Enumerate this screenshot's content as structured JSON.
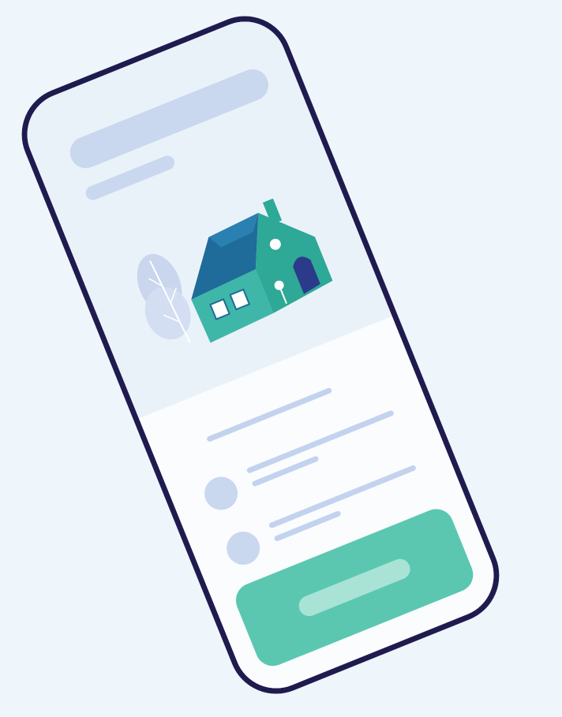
{
  "scene": {
    "background_color": "#eef6fb"
  },
  "phone": {
    "frame_color": "#1f1b4f",
    "screen_color": "#ffffff",
    "header_panel_color": "#eaf2f9",
    "placeholder_color": "#c9d8ef"
  },
  "illustration": {
    "icon": "house-illustration",
    "colors": {
      "roof": "#1f6b9a",
      "wall": "#3fb7a8",
      "wall_front": "#2ea897",
      "door": "#2c3a8a",
      "tree": "#c9d6ee"
    }
  },
  "list": {
    "items": [
      {
        "icon": "avatar-placeholder"
      },
      {
        "icon": "avatar-placeholder"
      },
      {
        "icon": "avatar-placeholder"
      }
    ]
  },
  "cta": {
    "color": "#5bc7b1",
    "label_color": "#a9e3d6"
  }
}
